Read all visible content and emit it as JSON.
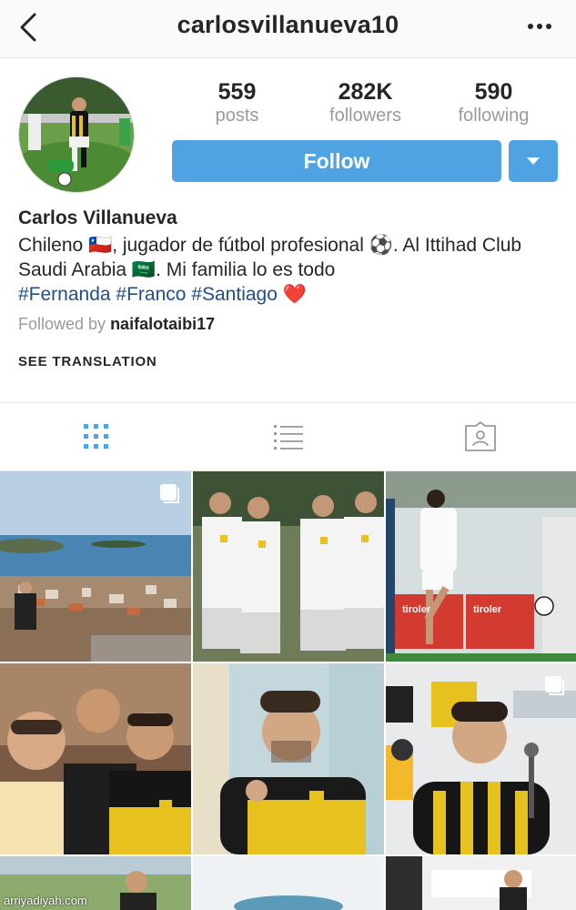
{
  "header": {
    "username": "carlosvillanueva10"
  },
  "stats": {
    "posts_count": "559",
    "posts_label": "posts",
    "followers_count": "282K",
    "followers_label": "followers",
    "following_count": "590",
    "following_label": "following"
  },
  "actions": {
    "follow_label": "Follow"
  },
  "profile": {
    "full_name": "Carlos Villanueva",
    "bio_part1": "Chileno 🇨🇱, jugador de fútbol profesional ⚽. Al Ittihad Club Saudi Arabia 🇸🇦. Mi familia lo es todo",
    "hashtag_1": "#Fernanda",
    "hashtag_2": "#Franco",
    "hashtag_3": "#Santiago",
    "bio_emoji_end": "❤️",
    "followed_by_prefix": "Followed by",
    "followed_by_user": "naifalotaibi17",
    "see_translation": "SEE TRANSLATION"
  },
  "tabs": [
    {
      "name": "grid",
      "icon": "grid-icon",
      "active": true
    },
    {
      "name": "list",
      "icon": "list-icon",
      "active": false
    },
    {
      "name": "tagged",
      "icon": "tagged-icon",
      "active": false
    }
  ],
  "watermark": "arriyadiyah.com",
  "colors": {
    "follow_blue": "#4fa3e3",
    "hashtag": "#1e4f8a",
    "muted": "#9a9a9a",
    "active_tab": "#4fa3e3",
    "inactive_tab": "#999999"
  }
}
